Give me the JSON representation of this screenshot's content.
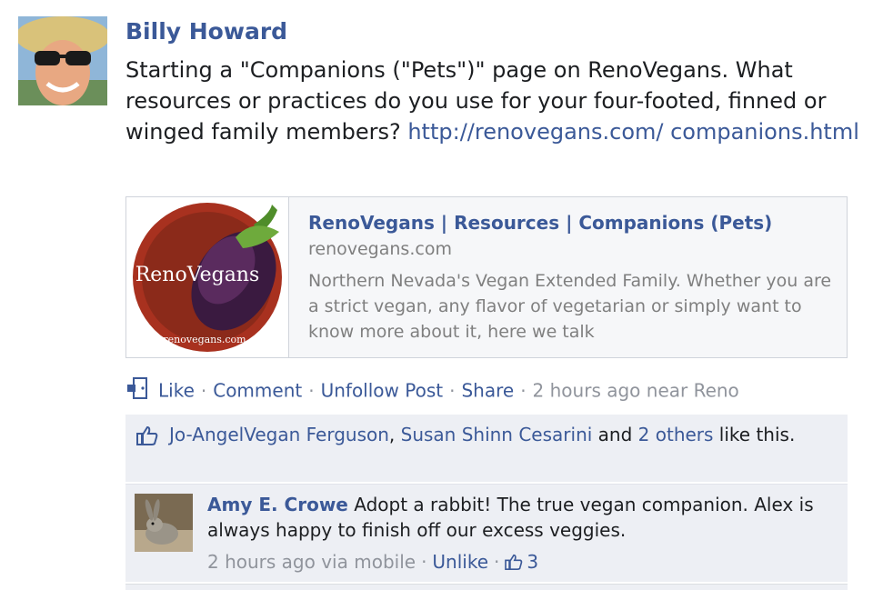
{
  "post": {
    "author": "Billy Howard",
    "message_text": "Starting a \"Companions (\"Pets\")\" page on RenoVegans. What resources or practices do you use for your four-footed, finned or winged family members? ",
    "message_link": "http://renovegans.com/ companions.html"
  },
  "attachment": {
    "thumb_text": "RenoVegans",
    "thumb_url": "renovegans.com",
    "title": "RenoVegans | Resources | Companions (Pets)",
    "domain": "renovegans.com",
    "description": "Northern Nevada's Vegan Extended Family. Whether you are a strict vegan, any flavor of vegetarian or simply want to know more about it, here we talk"
  },
  "actions": {
    "like": "Like",
    "comment": "Comment",
    "unfollow": "Unfollow Post",
    "share": "Share",
    "time": "2 hours ago near Reno",
    "separator": "·"
  },
  "likes": {
    "liker1": "Jo-AngelVegan Ferguson",
    "comma": ", ",
    "liker2": "Susan Shinn Cesarini",
    "and": " and ",
    "others": "2 others",
    "suffix": " like this."
  },
  "comment": {
    "author": "Amy E. Crowe",
    "text": "Adopt a rabbit! The true vegan companion. Alex is always happy to finish off our excess veggies.",
    "meta_time": "2 hours ago via mobile",
    "unlike": "Unlike",
    "like_count": "3",
    "separator": "·"
  },
  "colors": {
    "link": "#3b5998",
    "muted": "#90949c",
    "panel_bg": "#edeff4"
  }
}
